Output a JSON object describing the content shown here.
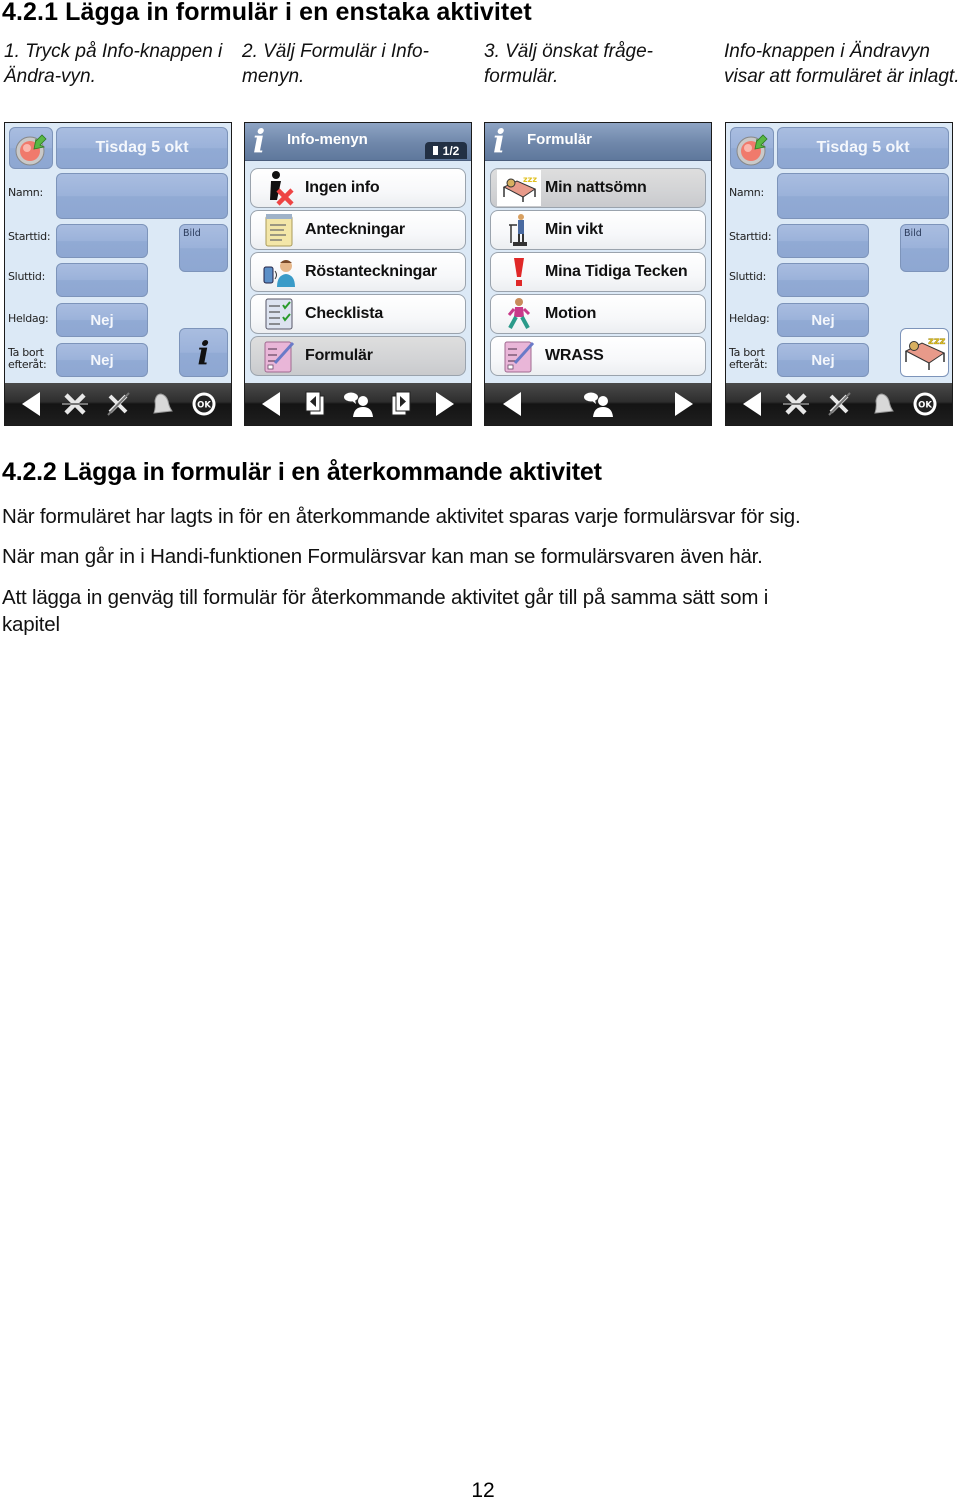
{
  "section1": {
    "heading": "4.2.1 Lägga in formulär i en enstaka aktivitet",
    "captions": [
      "1. Tryck på Info-knappen i Ändra-vyn.",
      "2. Välj Formulär i Info-menyn.",
      "3. Välj önskat fråge-formulär.",
      "Info-knappen i Ändravyn visar att formuläret är inlagt."
    ]
  },
  "screens": {
    "edit_view": {
      "date_title": "Tisdag 5 okt",
      "labels": {
        "name": "Namn:",
        "start": "Starttid:",
        "end": "Sluttid:",
        "allday": "Heldag:",
        "remove_line1": "Ta bort",
        "remove_line2": "efteråt:"
      },
      "image_label": "Bild",
      "allday_value": "Nej",
      "remove_value": "Nej",
      "info_icon": "i",
      "toolbar_icons": [
        "back-arrow-icon",
        "delete-icon",
        "cancel-icon",
        "alarm-bell-icon",
        "ok-icon"
      ],
      "ok_label": "OK"
    },
    "info_menu": {
      "title": "Info-menyn",
      "page_indicator": "1/2",
      "items": [
        {
          "label": "Ingen info",
          "icon": "no-info-icon",
          "selected": false
        },
        {
          "label": "Anteckningar",
          "icon": "notepad-icon",
          "selected": false
        },
        {
          "label": "Röstanteckningar",
          "icon": "voice-note-icon",
          "selected": false
        },
        {
          "label": "Checklista",
          "icon": "checklist-icon",
          "selected": false
        },
        {
          "label": "Formulär",
          "icon": "form-icon",
          "selected": true
        }
      ],
      "toolbar_icons": [
        "back-arrow-icon",
        "previous-page-icon",
        "speech-person-icon",
        "next-page-icon",
        "forward-arrow-icon"
      ]
    },
    "form_menu": {
      "title": "Formulär",
      "items": [
        {
          "label": "Min nattsömn",
          "icon": "sleeping-bed-icon",
          "selected": true
        },
        {
          "label": "Min vikt",
          "icon": "weight-scale-icon",
          "selected": false
        },
        {
          "label": "Mina Tidiga Tecken",
          "icon": "exclamation-icon",
          "selected": false
        },
        {
          "label": "Motion",
          "icon": "walking-person-icon",
          "selected": false
        },
        {
          "label": "WRASS",
          "icon": "form-icon",
          "selected": false
        }
      ],
      "toolbar_icons": [
        "back-arrow-icon",
        "speech-person-icon",
        "forward-arrow-icon"
      ]
    }
  },
  "section2": {
    "heading": "4.2.2 Lägga in formulär i en återkommande aktivitet",
    "paragraphs": [
      "När formuläret har lagts in för en återkommande aktivitet sparas varje formulärsvar för sig.",
      "När man går in i Handi-funktionen Formulärsvar kan man se formulärsvaren även här.",
      "Att lägga in genväg till formulär för återkommande aktivitet går till på samma sätt som i",
      "kapitel"
    ]
  },
  "page_number": "12"
}
